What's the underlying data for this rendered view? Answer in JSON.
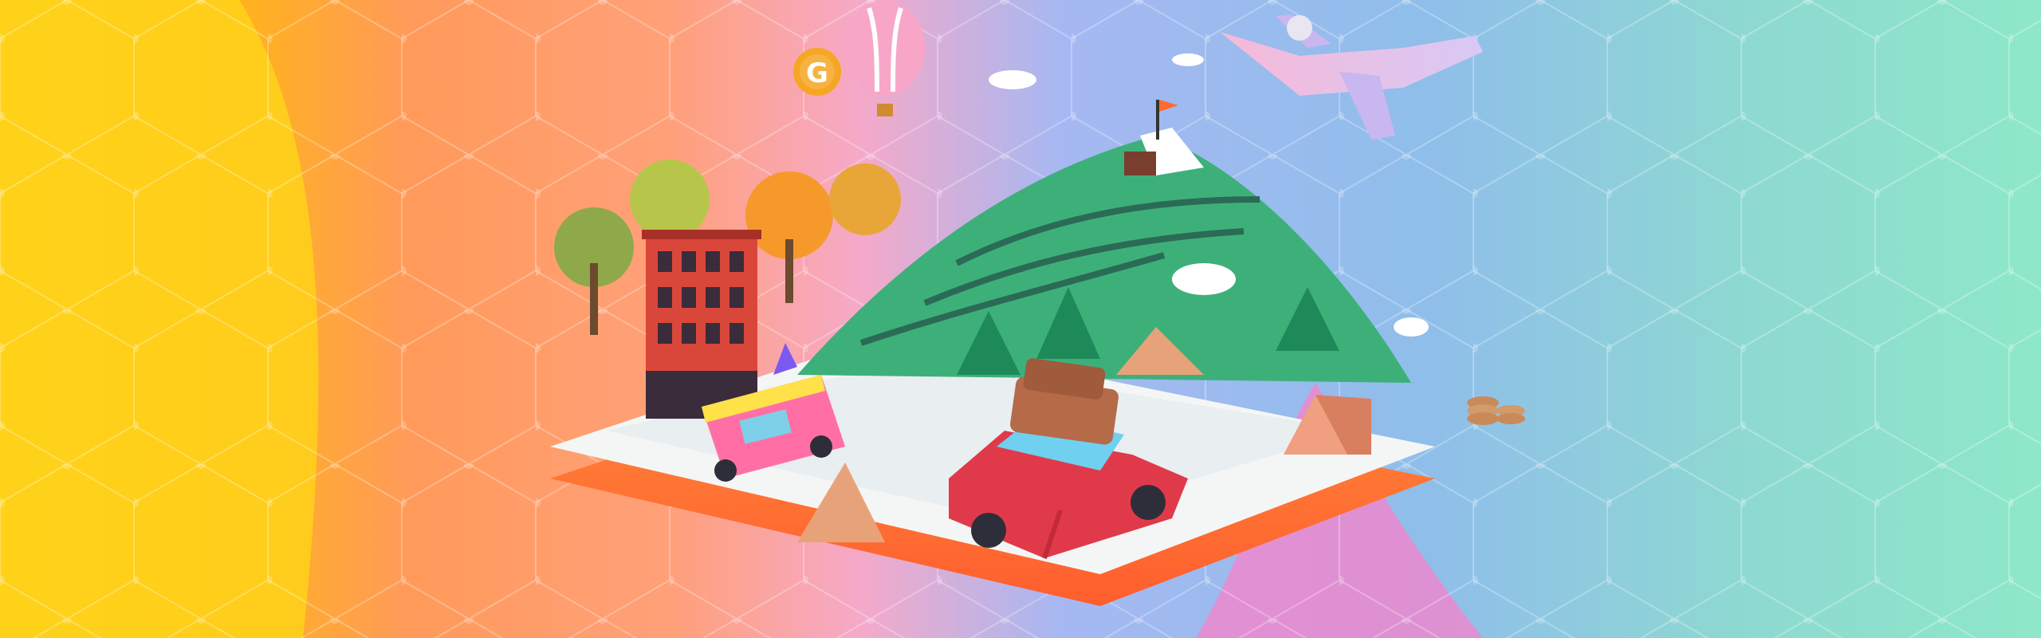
{
  "banner": {
    "logo_letter": "G",
    "palette": {
      "yellow": "#FFD21A",
      "orange": "#FF9A5A",
      "pink": "#FF8FC8",
      "sky": "#8FB8F0",
      "mint": "#8EE8C8",
      "grass": "#3DB07A",
      "platform": "#F4F6F5",
      "platform_edge": "#FF7A2E",
      "brick": "#D9473A",
      "car": "#E03A4A",
      "truck": "#FF6FA5"
    },
    "objects": [
      "hot-air-balloon",
      "airplane",
      "g-coin-icon",
      "brick-building",
      "autumn-trees",
      "green-mountain",
      "pink-food-truck",
      "red-car-with-suitcases",
      "stacked-coins",
      "camping-tent"
    ]
  }
}
